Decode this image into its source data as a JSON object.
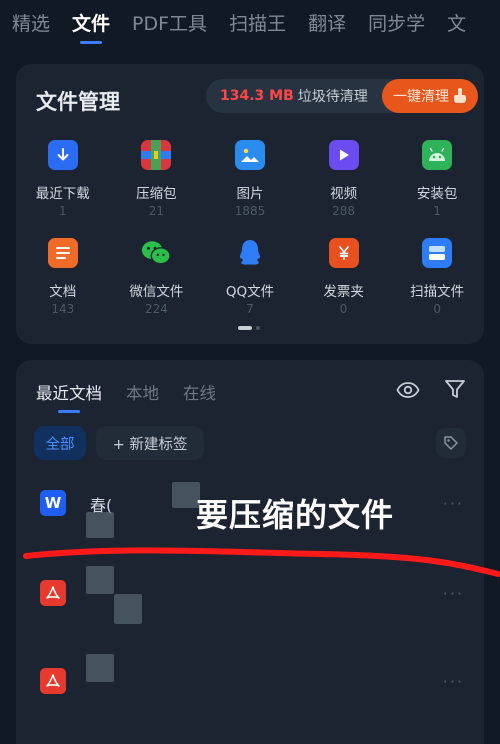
{
  "top_tabs": [
    "精选",
    "文件",
    "PDF工具",
    "扫描王",
    "翻译",
    "同步学",
    "文"
  ],
  "file_manager": {
    "title": "文件管理",
    "junk_size": "134.3 MB",
    "junk_text": "垃圾待清理",
    "clean_button": "一键清理",
    "categories": [
      {
        "label": "最近下载",
        "count": "1",
        "icon": "download-icon",
        "color": "#2a6df4"
      },
      {
        "label": "压缩包",
        "count": "21",
        "icon": "archive-icon",
        "color": "#d9363e"
      },
      {
        "label": "图片",
        "count": "1885",
        "icon": "image-icon",
        "color": "#2b8cf0"
      },
      {
        "label": "视频",
        "count": "288",
        "icon": "video-icon",
        "color": "#6a4cf0"
      },
      {
        "label": "安装包",
        "count": "1",
        "icon": "android-icon",
        "color": "#2fb35a"
      },
      {
        "label": "文档",
        "count": "143",
        "icon": "document-icon",
        "color": "#f06a28"
      },
      {
        "label": "微信文件",
        "count": "224",
        "icon": "wechat-icon",
        "color": "#2bbf4a"
      },
      {
        "label": "QQ文件",
        "count": "7",
        "icon": "qq-icon",
        "color": "#2f7df6"
      },
      {
        "label": "发票夹",
        "count": "0",
        "icon": "invoice-icon",
        "color": "#e8501f"
      },
      {
        "label": "扫描文件",
        "count": "0",
        "icon": "scan-icon",
        "color": "#2f7df6"
      }
    ]
  },
  "recent_docs": {
    "tabs": [
      "最近文档",
      "本地",
      "在线"
    ],
    "chip_all": "全部",
    "chip_new_tag": "+ 新建标签",
    "files": [
      {
        "type": "word",
        "badge": "W",
        "name": "春("
      },
      {
        "type": "pdf",
        "badge": "",
        "name": ""
      },
      {
        "type": "pdf",
        "badge": "",
        "name": ""
      }
    ],
    "more": "···"
  },
  "annotation": "要压缩的文件"
}
